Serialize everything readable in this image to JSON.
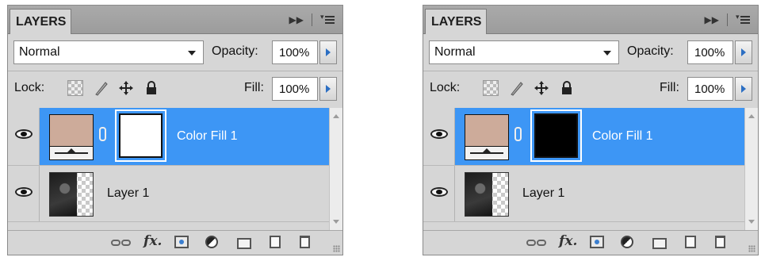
{
  "panels": [
    {
      "tab_label": "LAYERS",
      "header_icons": [
        "panel-collapse-icon",
        "panel-menu-icon"
      ],
      "blend_mode": "Normal",
      "opacity_label": "Opacity:",
      "opacity_value": "100%",
      "lock_label": "Lock:",
      "lock_icons": [
        "lock-transparent-pixels-icon",
        "lock-image-pixels-icon",
        "lock-position-icon",
        "lock-all-icon"
      ],
      "fill_label": "Fill:",
      "fill_value": "100%",
      "layers": [
        {
          "name": "Color Fill 1",
          "selected": true,
          "fill_color": "#cdab9a",
          "mask_color": "#ffffff"
        },
        {
          "name": "Layer 1",
          "selected": false
        }
      ],
      "footer_icons": [
        "link-layers-icon",
        "fx-icon",
        "add-mask-icon",
        "adjustment-layer-icon",
        "new-group-icon",
        "new-layer-icon",
        "trash-icon"
      ]
    },
    {
      "tab_label": "LAYERS",
      "header_icons": [
        "panel-collapse-icon",
        "panel-menu-icon"
      ],
      "blend_mode": "Normal",
      "opacity_label": "Opacity:",
      "opacity_value": "100%",
      "lock_label": "Lock:",
      "lock_icons": [
        "lock-transparent-pixels-icon",
        "lock-image-pixels-icon",
        "lock-position-icon",
        "lock-all-icon"
      ],
      "fill_label": "Fill:",
      "fill_value": "100%",
      "layers": [
        {
          "name": "Color Fill 1",
          "selected": true,
          "fill_color": "#cdab9a",
          "mask_color": "#000000"
        },
        {
          "name": "Layer 1",
          "selected": false
        }
      ],
      "footer_icons": [
        "link-layers-icon",
        "fx-icon",
        "add-mask-icon",
        "adjustment-layer-icon",
        "new-group-icon",
        "new-layer-icon",
        "trash-icon"
      ]
    }
  ],
  "colors": {
    "selection": "#3d96f5",
    "panel_bg": "#d6d6d6",
    "header_bg": "#a3a3a3"
  }
}
